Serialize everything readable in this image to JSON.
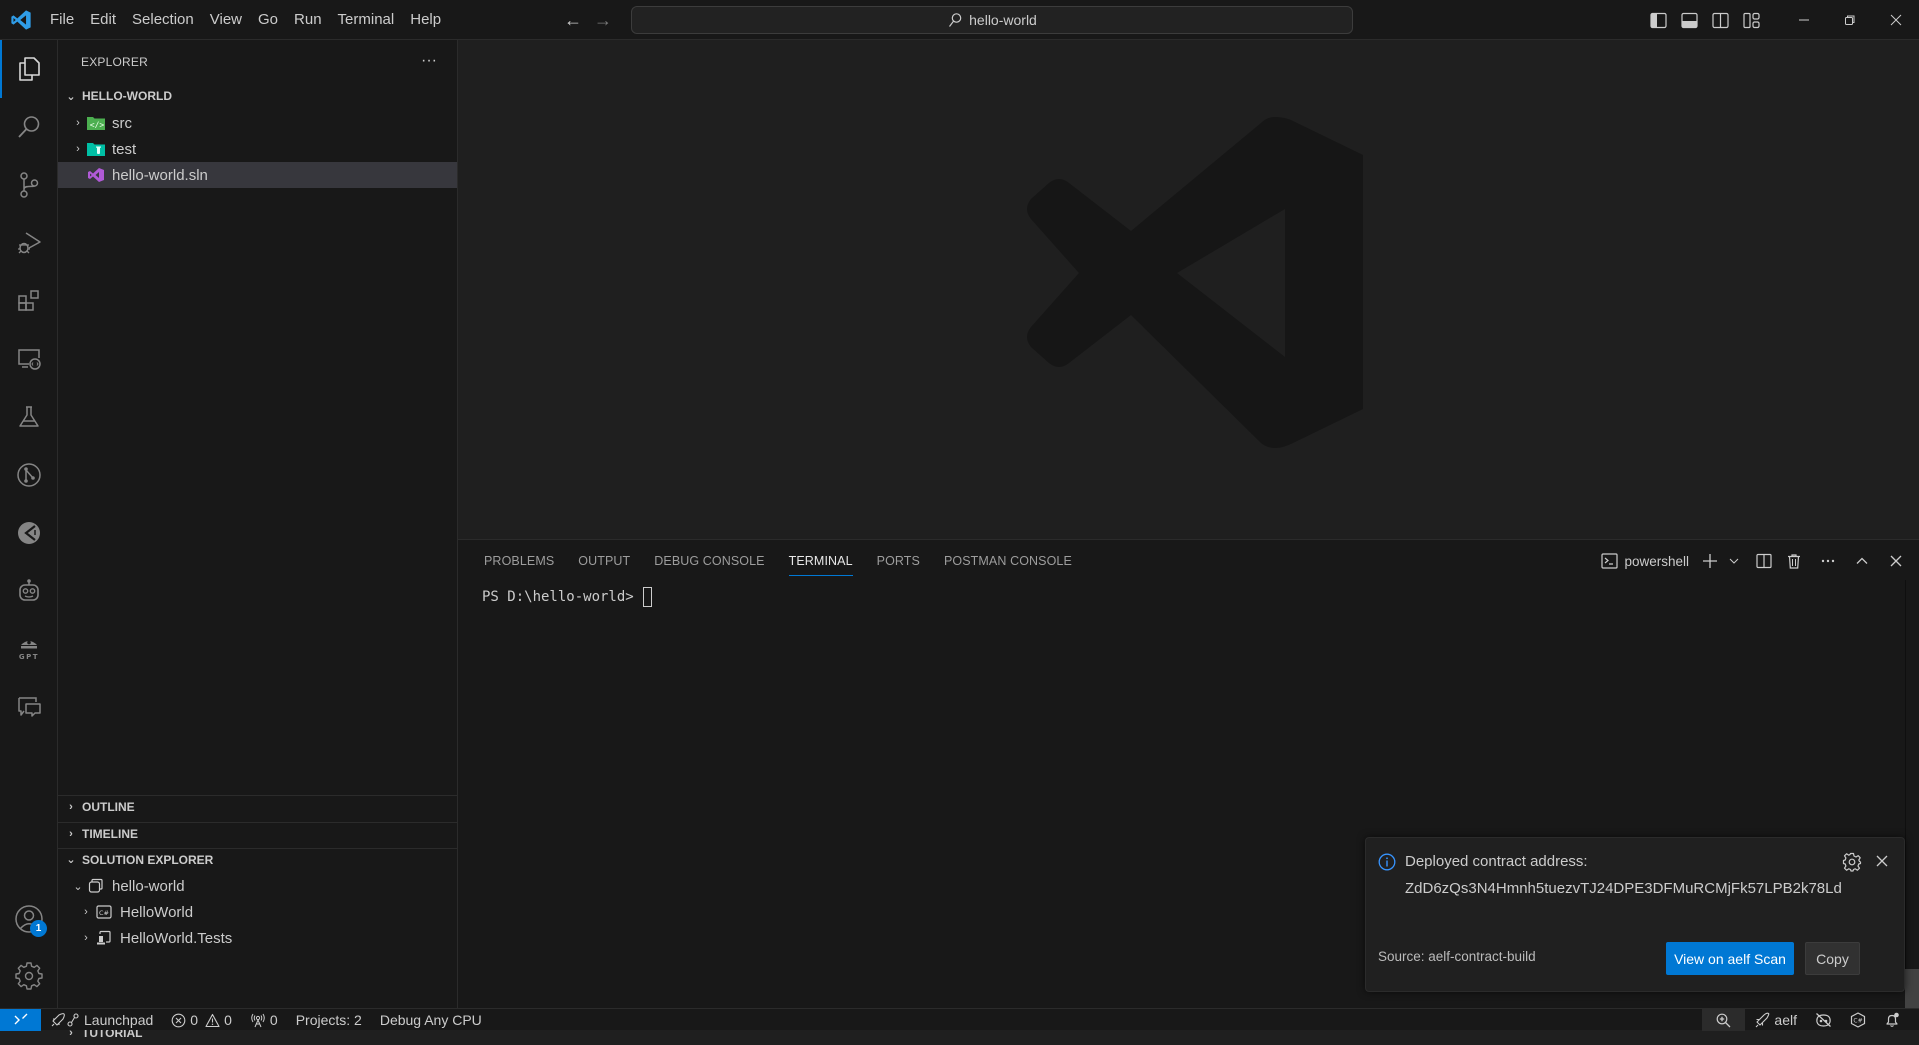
{
  "titlebar": {
    "menu": [
      "File",
      "Edit",
      "Selection",
      "View",
      "Go",
      "Run",
      "Terminal",
      "Help"
    ],
    "command_center": "hello-world",
    "layout_buttons": [
      "toggle-primary-sidebar",
      "toggle-panel",
      "toggle-secondary-sidebar",
      "customize-layout"
    ],
    "window_buttons": [
      "minimize",
      "restore",
      "close"
    ]
  },
  "activitybar": {
    "items": [
      {
        "name": "explorer",
        "active": true
      },
      {
        "name": "search"
      },
      {
        "name": "source-control"
      },
      {
        "name": "run-and-debug"
      },
      {
        "name": "extensions"
      },
      {
        "name": "remote-explorer"
      },
      {
        "name": "testing"
      },
      {
        "name": "git-graph"
      },
      {
        "name": "postman"
      },
      {
        "name": "copilot-bot"
      },
      {
        "name": "gpt"
      },
      {
        "name": "chat"
      }
    ],
    "accounts_badge": "1"
  },
  "sidebar": {
    "title": "EXPLORER",
    "more": "···",
    "workspace": "HELLO-WORLD",
    "files": [
      {
        "label": "src",
        "type": "folder-src",
        "expanded": false
      },
      {
        "label": "test",
        "type": "folder-test",
        "expanded": false
      },
      {
        "label": "hello-world.sln",
        "type": "sln",
        "selected": true
      }
    ],
    "sections": {
      "outline": "OUTLINE",
      "timeline": "TIMELINE",
      "solution_explorer": "SOLUTION EXPLORER",
      "tutorial": "TUTORIAL"
    },
    "solution": {
      "root": "hello-world",
      "projects": [
        "HelloWorld",
        "HelloWorld.Tests"
      ]
    }
  },
  "panel": {
    "tabs": [
      "PROBLEMS",
      "OUTPUT",
      "DEBUG CONSOLE",
      "TERMINAL",
      "PORTS",
      "POSTMAN CONSOLE"
    ],
    "active_tab": "TERMINAL",
    "terminal_name": "powershell",
    "prompt": "PS D:\\hello-world>"
  },
  "notification": {
    "title": "Deployed contract address:",
    "address": "ZdD6zQs3N4Hmnh5tuezvTJ24DPE3DFMuRCMjFk57LPB2k78Ld",
    "source": "Source: aelf-contract-build",
    "primary_button": "View on aelf Scan",
    "secondary_button": "Copy"
  },
  "statusbar": {
    "launchpad": "Launchpad",
    "errors": "0",
    "warnings": "0",
    "ports": "0",
    "projects": "Projects: 2",
    "config": "Debug Any CPU",
    "aelf": "aelf"
  },
  "colors": {
    "accent": "#0078d4",
    "background": "#1f1f1f",
    "sidebar": "#181818",
    "selection": "#37373d"
  }
}
